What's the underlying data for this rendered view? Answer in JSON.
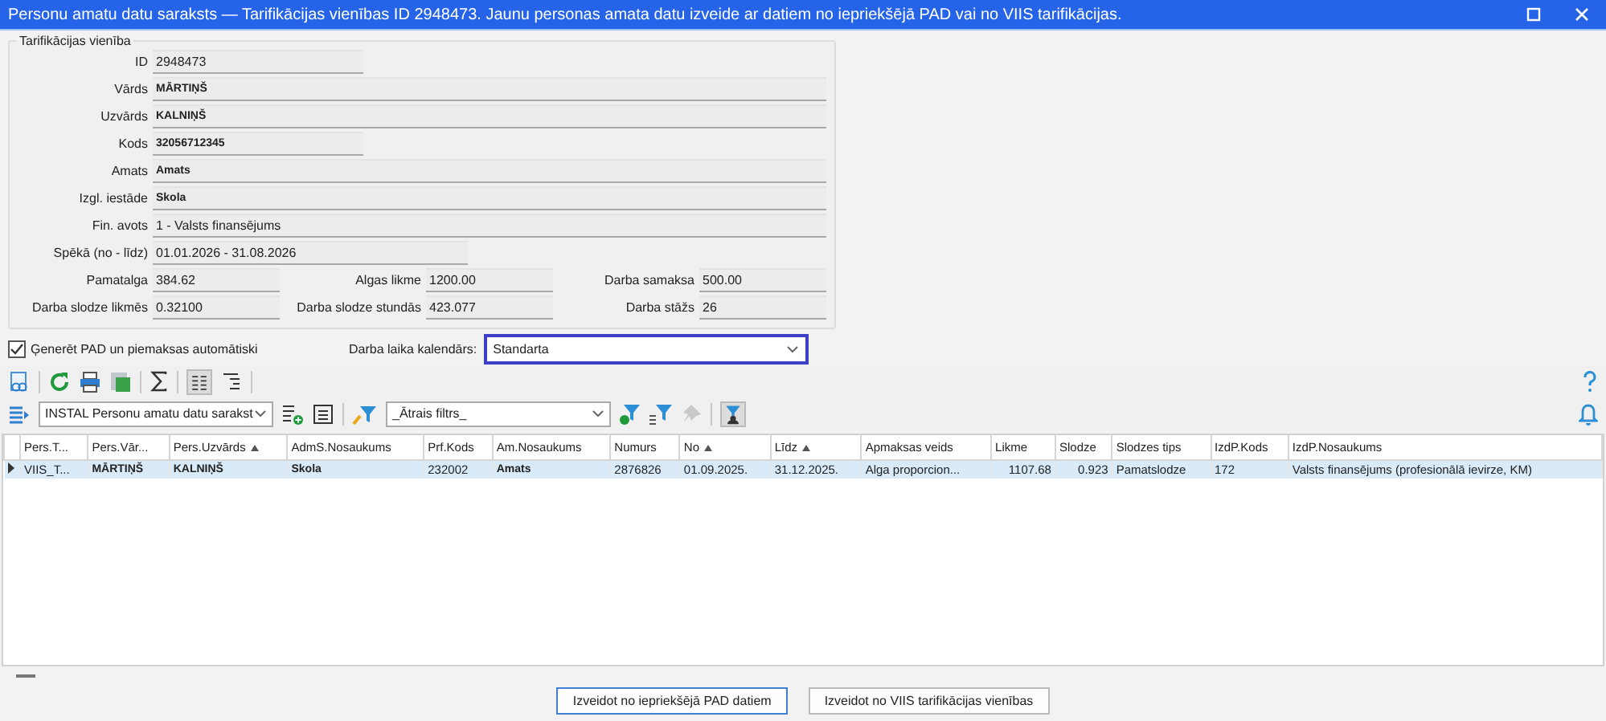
{
  "window": {
    "title": "Personu amatu datu saraksts — Tarifikācijas vienības ID 2948473. Jaunu personas amata datu izveide ar datiem no iepriekšējā PAD vai no VIIS tarifikācijas."
  },
  "group": {
    "title": "Tarifikācijas vienība",
    "fields": [
      {
        "label": "ID",
        "value": "2948473",
        "kind": "short"
      },
      {
        "label": "Vārds",
        "value": "MĀRTIŅŠ",
        "kind": "long-bold"
      },
      {
        "label": "Uzvārds",
        "value": "KALNIŅŠ",
        "kind": "long-bold"
      },
      {
        "label": "Kods",
        "value": "32056712345",
        "kind": "short-bold"
      },
      {
        "label": "Amats",
        "value": "Amats",
        "kind": "long-bold"
      },
      {
        "label": "Izgl. iestāde",
        "value": "Skola",
        "kind": "long-bold"
      },
      {
        "label": "Fin. avots",
        "value": "1 - Valsts finansējums",
        "kind": "long"
      },
      {
        "label": "Spēkā (no - līdz)",
        "value": "01.01.2026 - 31.08.2026",
        "kind": "medium"
      }
    ],
    "grid_rows": [
      [
        {
          "label": "Pamatalga",
          "value": "384.62"
        },
        {
          "label": "Algas likme",
          "value": "1200.00"
        },
        {
          "label": "Darba samaksa",
          "value": "500.00"
        }
      ],
      [
        {
          "label": "Darba slodze likmēs",
          "value": "0.32100"
        },
        {
          "label": "Darba slodze stundās",
          "value": "423.077"
        },
        {
          "label": "Darba stāžs",
          "value": "26"
        }
      ]
    ]
  },
  "auto_checkbox": {
    "label": "Ģenerēt PAD un piemaksas automātiski",
    "checked": true
  },
  "calendar": {
    "label": "Darba laika kalendārs:",
    "value": "Standarta",
    "focused": true
  },
  "layout_select": {
    "value": "INSTAL Personu amatu datu sarakst"
  },
  "quick_filter": {
    "value": "_Ātrais filtrs_"
  },
  "table": {
    "columns": [
      {
        "label": "Pers.T...",
        "sorted": false,
        "kind": "text"
      },
      {
        "label": "Pers.Vār...",
        "sorted": false,
        "kind": "text"
      },
      {
        "label": "Pers.Uzvārds",
        "sorted": true,
        "kind": "text"
      },
      {
        "label": "AdmS.Nosaukums",
        "sorted": false,
        "kind": "text"
      },
      {
        "label": "Prf.Kods",
        "sorted": false,
        "kind": "text"
      },
      {
        "label": "Am.Nosaukums",
        "sorted": false,
        "kind": "text"
      },
      {
        "label": "Numurs",
        "sorted": false,
        "kind": "text"
      },
      {
        "label": "No",
        "sorted": true,
        "kind": "text"
      },
      {
        "label": "Līdz",
        "sorted": true,
        "kind": "text"
      },
      {
        "label": "Apmaksas veids",
        "sorted": false,
        "kind": "text"
      },
      {
        "label": "Likme",
        "sorted": false,
        "kind": "number"
      },
      {
        "label": "Slodze",
        "sorted": false,
        "kind": "number"
      },
      {
        "label": "Slodzes tips",
        "sorted": false,
        "kind": "text"
      },
      {
        "label": "IzdP.Kods",
        "sorted": false,
        "kind": "text"
      },
      {
        "label": "IzdP.Nosaukums",
        "sorted": false,
        "kind": "text"
      }
    ],
    "rows": [
      {
        "selected": true,
        "cells": [
          "VIIS_T...",
          "MĀRTIŅŠ",
          "KALNIŅŠ",
          "Skola",
          "232002",
          "Amats",
          "2876826",
          "01.09.2025.",
          "31.12.2025.",
          "Alga proporcion...",
          "1107.68",
          "0.923",
          "Pamatslodze",
          "172",
          "Valsts finansējums (profesionālā ievirze, KM)"
        ]
      }
    ]
  },
  "buttons": [
    {
      "label": "Izveidot no iepriekšējā PAD datiem",
      "default": true
    },
    {
      "label": "Izveidot no VIIS tarifikācijas vienības",
      "default": false
    }
  ]
}
